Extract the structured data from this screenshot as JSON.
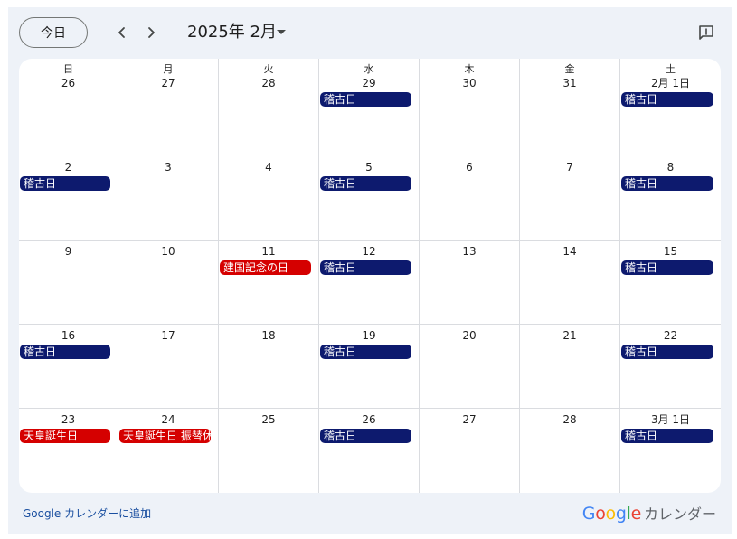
{
  "toolbar": {
    "today_label": "今日",
    "prev_icon": "chevron-left-icon",
    "next_icon": "chevron-right-icon",
    "month_title": "2025年 2月",
    "month_caret_icon": "caret-down-icon",
    "feedback_icon": "feedback-icon"
  },
  "weekdays": [
    "日",
    "月",
    "火",
    "水",
    "木",
    "金",
    "土"
  ],
  "weeks": [
    [
      {
        "date": "26",
        "events": []
      },
      {
        "date": "27",
        "events": []
      },
      {
        "date": "28",
        "events": []
      },
      {
        "date": "29",
        "events": [
          {
            "title": "稽古日",
            "kind": "practice"
          }
        ]
      },
      {
        "date": "30",
        "events": []
      },
      {
        "date": "31",
        "events": []
      },
      {
        "date": "2月 1日",
        "events": [
          {
            "title": "稽古日",
            "kind": "practice"
          }
        ]
      }
    ],
    [
      {
        "date": "2",
        "events": [
          {
            "title": "稽古日",
            "kind": "practice"
          }
        ]
      },
      {
        "date": "3",
        "events": []
      },
      {
        "date": "4",
        "events": []
      },
      {
        "date": "5",
        "events": [
          {
            "title": "稽古日",
            "kind": "practice"
          }
        ]
      },
      {
        "date": "6",
        "events": []
      },
      {
        "date": "7",
        "events": []
      },
      {
        "date": "8",
        "events": [
          {
            "title": "稽古日",
            "kind": "practice"
          }
        ]
      }
    ],
    [
      {
        "date": "9",
        "events": []
      },
      {
        "date": "10",
        "events": []
      },
      {
        "date": "11",
        "events": [
          {
            "title": "建国記念の日",
            "kind": "holiday"
          }
        ]
      },
      {
        "date": "12",
        "events": [
          {
            "title": "稽古日",
            "kind": "practice"
          }
        ]
      },
      {
        "date": "13",
        "events": []
      },
      {
        "date": "14",
        "events": []
      },
      {
        "date": "15",
        "events": [
          {
            "title": "稽古日",
            "kind": "practice"
          }
        ]
      }
    ],
    [
      {
        "date": "16",
        "events": [
          {
            "title": "稽古日",
            "kind": "practice"
          }
        ]
      },
      {
        "date": "17",
        "events": []
      },
      {
        "date": "18",
        "events": []
      },
      {
        "date": "19",
        "events": [
          {
            "title": "稽古日",
            "kind": "practice"
          }
        ]
      },
      {
        "date": "20",
        "events": []
      },
      {
        "date": "21",
        "events": []
      },
      {
        "date": "22",
        "events": [
          {
            "title": "稽古日",
            "kind": "practice"
          }
        ]
      }
    ],
    [
      {
        "date": "23",
        "events": [
          {
            "title": "天皇誕生日",
            "kind": "holiday"
          }
        ]
      },
      {
        "date": "24",
        "events": [
          {
            "title": "天皇誕生日 振替休日",
            "kind": "holiday"
          }
        ]
      },
      {
        "date": "25",
        "events": []
      },
      {
        "date": "26",
        "events": [
          {
            "title": "稽古日",
            "kind": "practice"
          }
        ]
      },
      {
        "date": "27",
        "events": []
      },
      {
        "date": "28",
        "events": []
      },
      {
        "date": "3月 1日",
        "events": [
          {
            "title": "稽古日",
            "kind": "practice"
          }
        ]
      }
    ]
  ],
  "colors": {
    "practice": "#0d1a6e",
    "holiday": "#d50000",
    "google_blue": "#4285f4",
    "google_red": "#ea4335",
    "google_yellow": "#fbbc05",
    "google_green": "#34a853"
  },
  "footer": {
    "add_link": "Google カレンダーに追加",
    "brand_google": "Google",
    "brand_calendar": "カレンダー"
  }
}
